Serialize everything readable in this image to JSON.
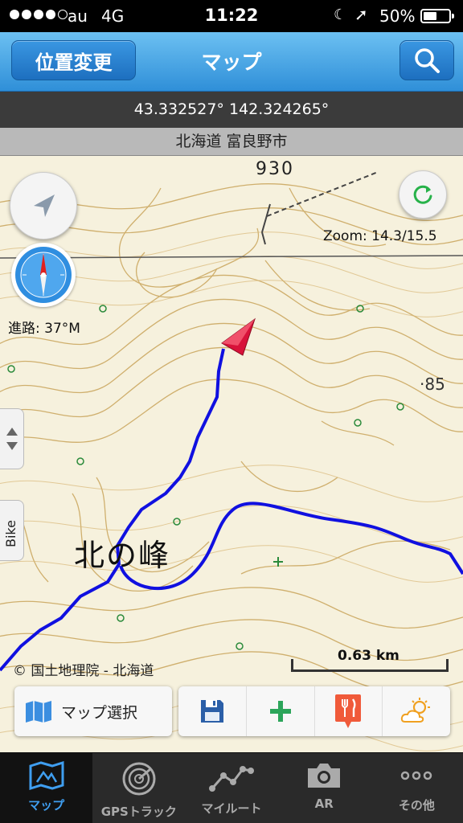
{
  "status": {
    "carrier": "au",
    "network": "4G",
    "time": "11:22",
    "battery": "50%"
  },
  "navbar": {
    "left_button": "位置変更",
    "title": "マップ"
  },
  "info": {
    "coordinates": "43.332527° 142.324265°",
    "place": "北海道 富良野市"
  },
  "map": {
    "elevation_1": "930",
    "elevation_2": "·85",
    "place_label": "北の峰",
    "zoom": "Zoom: 14.3/15.5",
    "heading": "進路: 37°M",
    "copyright": "© 国土地理院 - 北海道",
    "scale": "0.63 km",
    "side_mode": "Bike",
    "track_color": "#1010e0",
    "pointer_color": "#d8123a"
  },
  "toolbar": {
    "map_select": "マップ選択",
    "icons": [
      "save-icon",
      "add-icon",
      "restaurant-icon",
      "weather-icon"
    ]
  },
  "tabs": [
    {
      "label": "マップ",
      "icon": "map-icon",
      "active": true
    },
    {
      "label": "GPSトラック",
      "icon": "radar-icon",
      "active": false
    },
    {
      "label": "マイルート",
      "icon": "route-icon",
      "active": false
    },
    {
      "label": "AR",
      "icon": "camera-icon",
      "active": false
    },
    {
      "label": "その他",
      "icon": "more-icon",
      "active": false
    }
  ]
}
